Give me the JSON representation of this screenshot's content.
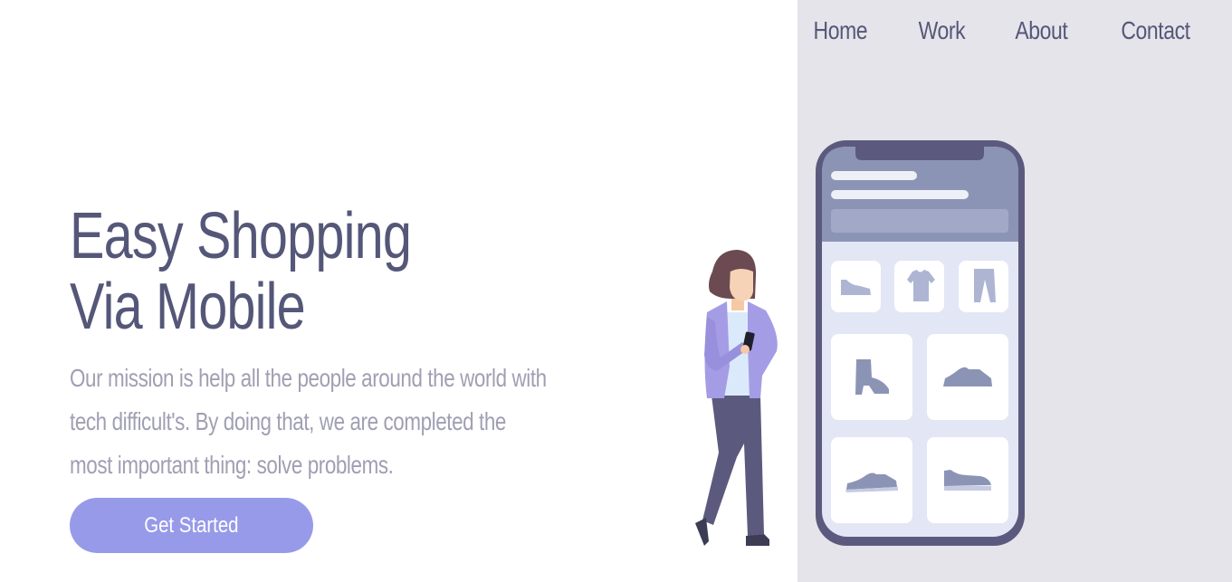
{
  "nav": {
    "items": [
      {
        "label": "Home"
      },
      {
        "label": "Work"
      },
      {
        "label": "About"
      },
      {
        "label": "Contact"
      }
    ]
  },
  "hero": {
    "title_line1": "Easy Shopping",
    "title_line2": "Via Mobile",
    "description": "Our mission is help all the people around the world with tech difficult's. By doing that, we are completed the most important thing: solve problems.",
    "cta_label": "Get Started"
  },
  "colors": {
    "background": "#ffffff",
    "panel": "#e5e4ea",
    "heading": "#555779",
    "body_text": "#a09fb3",
    "cta": "#979ae9",
    "phone_frame": "#5b5a7e"
  },
  "illustration": {
    "subject": "woman holding phone next to shopping app phone mockup",
    "product_icons": [
      "shoe-icon",
      "tshirt-icon",
      "pants-icon",
      "boot-icon",
      "sneaker-icon",
      "sneaker-icon",
      "sneaker-icon"
    ]
  }
}
